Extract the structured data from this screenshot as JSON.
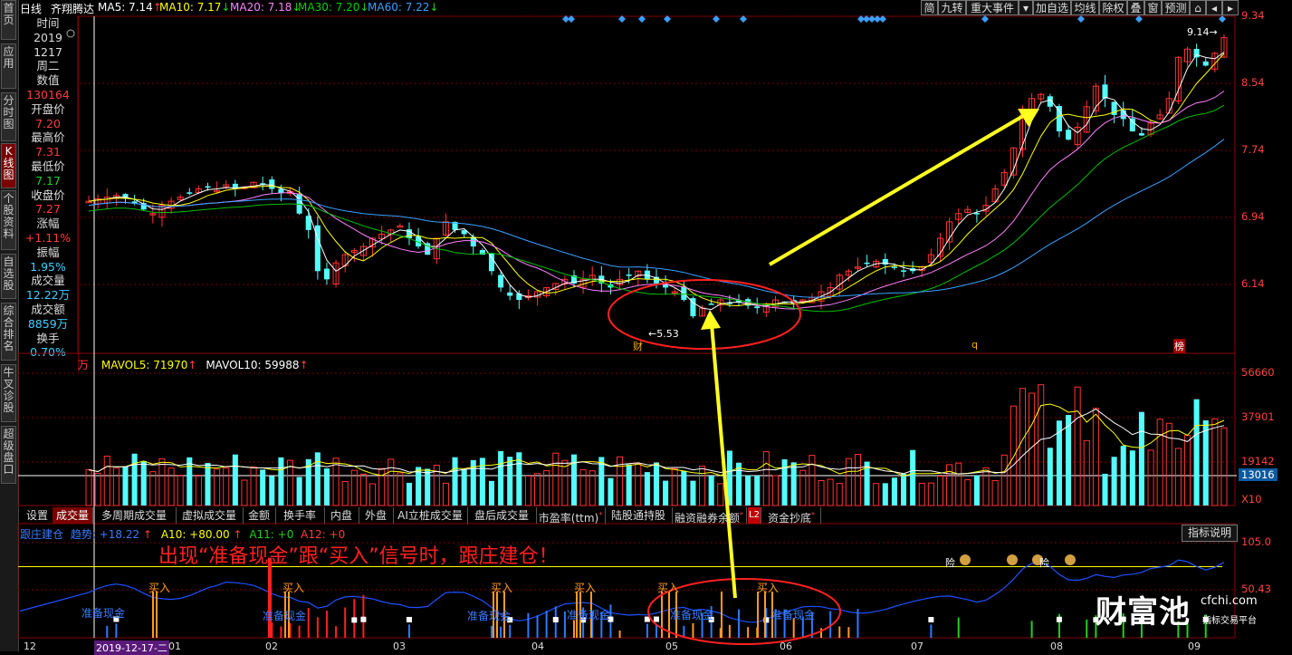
{
  "topbar": {
    "period": "日线",
    "stock_name": "齐翔腾达",
    "ma5": "MA5: 7.14",
    "ma10": "MA10: 7.17",
    "ma20": "MA20: 7.18",
    "ma30": "MA30: 7.20",
    "ma60": "MA60: 7.22",
    "buttons": [
      "简",
      "九转",
      "重大事件",
      "加自选",
      "均线",
      "除权",
      "叠",
      "窗",
      "预测"
    ]
  },
  "left_tabs": [
    "首页",
    "应用",
    "分时图",
    "K线图",
    "个股资料",
    "自选股",
    "综合排名",
    "牛叉诊股",
    "超级盘口"
  ],
  "info": {
    "time_label": "时间",
    "year": "2019",
    "date": "1217",
    "weekday": "周二",
    "value_label": "数值",
    "value": "130164",
    "open_label": "开盘价",
    "open": "7.20",
    "high_label": "最高价",
    "high": "7.31",
    "low_label": "最低价",
    "low": "7.17",
    "close_label": "收盘价",
    "close": "7.27",
    "change_label": "涨幅",
    "change": "+1.11%",
    "amplitude_label": "振幅",
    "amplitude": "1.95%",
    "volume_label": "成交量",
    "volume": "12.22万",
    "turnover_label": "成交额",
    "turnover": "8859万",
    "hand_label": "换手",
    "hand": "0.70%"
  },
  "price_axis": [
    "9.34",
    "8.54",
    "7.74",
    "6.94",
    "6.14"
  ],
  "price_annotations": {
    "high_mark": "9.14",
    "low_mark": "5.53",
    "tag_cai": "财",
    "tag_q": "q",
    "tag_bang": "榜"
  },
  "volume_header": {
    "unit": "万",
    "mavol5": "MAVOL5: 71970",
    "mavol10": "MAVOL10: 59988"
  },
  "volume_axis": [
    "56660",
    "37901",
    "19142",
    "13016",
    "X10"
  ],
  "bottom_tabs": [
    "设置",
    "成交量",
    "多周期成交量",
    "虚拟成交量",
    "金额",
    "换手率",
    "内盘",
    "外盘",
    "AI立桩成交量",
    "盘后成交量",
    "市盈率(ttm)",
    "陆股通持股",
    "融资融券余额",
    "L2",
    "资金抄底"
  ],
  "indicator": {
    "name": "跟庄建仓",
    "trend": "趋势: +18.22",
    "a10": "A10: +80.00",
    "a11": "A11: +0",
    "a12": "A12: +0",
    "help_button": "指标说明",
    "axis_top": "105.0",
    "axis_mid": "50.43",
    "headline": "出现“准备现金”跟“买入”信号时，跟庄建仓！",
    "zhunbei": "准备现金",
    "mairu": "买入",
    "bag_labels": [
      "险",
      "险"
    ]
  },
  "x_axis": [
    "12",
    "2019-12-17-二",
    "01",
    "02",
    "03",
    "04",
    "05",
    "06",
    "07",
    "08",
    "09"
  ],
  "watermark": {
    "brand": "财富池",
    "site": "cfchi.com",
    "slogan": "指标交易平台"
  },
  "colors": {
    "up": "#ff3232",
    "down": "#54fcfc",
    "ma5": "#ffffff",
    "ma10": "#ffff00",
    "ma20": "#ff80ff",
    "ma30": "#00c000",
    "ma60": "#3aa0ff",
    "arrow": "#ffff20",
    "circle": "#ff2020"
  },
  "chart_data": {
    "type": "candlestick",
    "price_ylim": [
      5.3,
      9.4
    ],
    "series": [
      {
        "name": "MA5",
        "value": 7.14
      },
      {
        "name": "MA10",
        "value": 7.17
      },
      {
        "name": "MA20",
        "value": 7.18
      },
      {
        "name": "MA30",
        "value": 7.2
      },
      {
        "name": "MA60",
        "value": 7.22
      }
    ],
    "closes": [
      7.15,
      7.18,
      7.2,
      7.22,
      7.18,
      7.12,
      7.05,
      7.0,
      7.1,
      7.15,
      7.2,
      7.25,
      7.3,
      7.32,
      7.28,
      7.35,
      7.3,
      7.32,
      7.38,
      7.36,
      7.3,
      7.25,
      7.27,
      7.0,
      6.8,
      6.3,
      6.2,
      6.4,
      6.5,
      6.55,
      6.6,
      6.7,
      6.75,
      6.8,
      6.85,
      6.7,
      6.6,
      6.5,
      6.7,
      6.9,
      6.8,
      6.75,
      6.6,
      6.5,
      6.3,
      6.1,
      6.0,
      5.95,
      6.0,
      6.05,
      6.1,
      6.15,
      6.2,
      6.15,
      6.2,
      6.25,
      6.15,
      6.1,
      6.2,
      6.25,
      6.3,
      6.2,
      6.15,
      6.1,
      6.05,
      5.95,
      5.75,
      5.85,
      5.9,
      5.95,
      5.9,
      5.92,
      5.88,
      5.85,
      5.9,
      5.95,
      5.92,
      5.9,
      5.95,
      5.98,
      6.05,
      6.1,
      6.25,
      6.3,
      6.35,
      6.4,
      6.42,
      6.38,
      6.35,
      6.3,
      6.3,
      6.35,
      6.5,
      6.7,
      6.9,
      7.0,
      7.05,
      7.0,
      7.1,
      7.3,
      7.5,
      7.8,
      8.2,
      8.4,
      8.45,
      8.3,
      8.0,
      7.9,
      8.05,
      8.3,
      8.55,
      8.4,
      8.2,
      8.15,
      8.0,
      7.95,
      8.1,
      8.2,
      8.4,
      8.9,
      9.0,
      8.9,
      8.8,
      8.95,
      9.14
    ],
    "volume_ylim": [
      0,
      60000
    ],
    "volume_levels": [
      56660,
      37901,
      19142,
      13016
    ],
    "indicator_ylim": [
      0,
      110
    ],
    "indicator_levels": [
      105.0,
      80.0,
      50.43
    ]
  }
}
